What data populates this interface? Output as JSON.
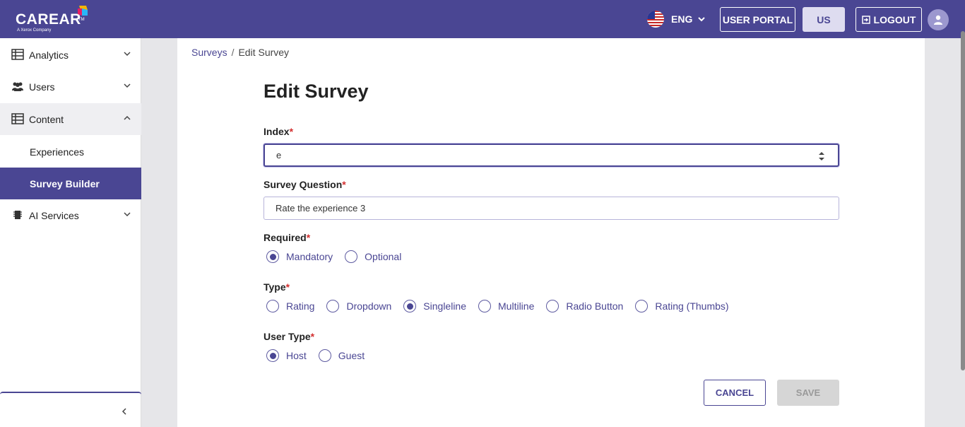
{
  "header": {
    "logo_text": "CAREAR",
    "logo_tm": "TM",
    "logo_sub": "A Xerox Company",
    "language": "ENG",
    "user_portal_label": "USER PORTAL",
    "region_label": "US",
    "logout_label": "LOGOUT"
  },
  "sidebar": {
    "items": [
      {
        "label": "Analytics",
        "icon": "table-icon",
        "expanded": false
      },
      {
        "label": "Users",
        "icon": "users-icon",
        "expanded": false
      },
      {
        "label": "Content",
        "icon": "table-icon",
        "expanded": true
      },
      {
        "label": "Experiences",
        "sub": true
      },
      {
        "label": "Survey Builder",
        "sub": true,
        "active": true
      },
      {
        "label": "AI Services",
        "icon": "chip-icon",
        "expanded": false
      }
    ]
  },
  "breadcrumb": {
    "root": "Surveys",
    "separator": "/",
    "current": "Edit Survey"
  },
  "form": {
    "title": "Edit Survey",
    "required_mark": "*",
    "index": {
      "label": "Index",
      "value": "e"
    },
    "question": {
      "label": "Survey Question",
      "value": "Rate the experience 3"
    },
    "required": {
      "label": "Required",
      "options": [
        "Mandatory",
        "Optional"
      ],
      "selected": "Mandatory"
    },
    "type": {
      "label": "Type",
      "options": [
        "Rating",
        "Dropdown",
        "Singleline",
        "Multiline",
        "Radio Button",
        "Rating (Thumbs)"
      ],
      "selected": "Singleline"
    },
    "user_type": {
      "label": "User Type",
      "options": [
        "Host",
        "Guest"
      ],
      "selected": "Host"
    },
    "cancel_label": "CANCEL",
    "save_label": "SAVE"
  },
  "colors": {
    "brand": "#4a4693",
    "required": "#d32f2f",
    "save_disabled_bg": "#d6d6d6"
  }
}
